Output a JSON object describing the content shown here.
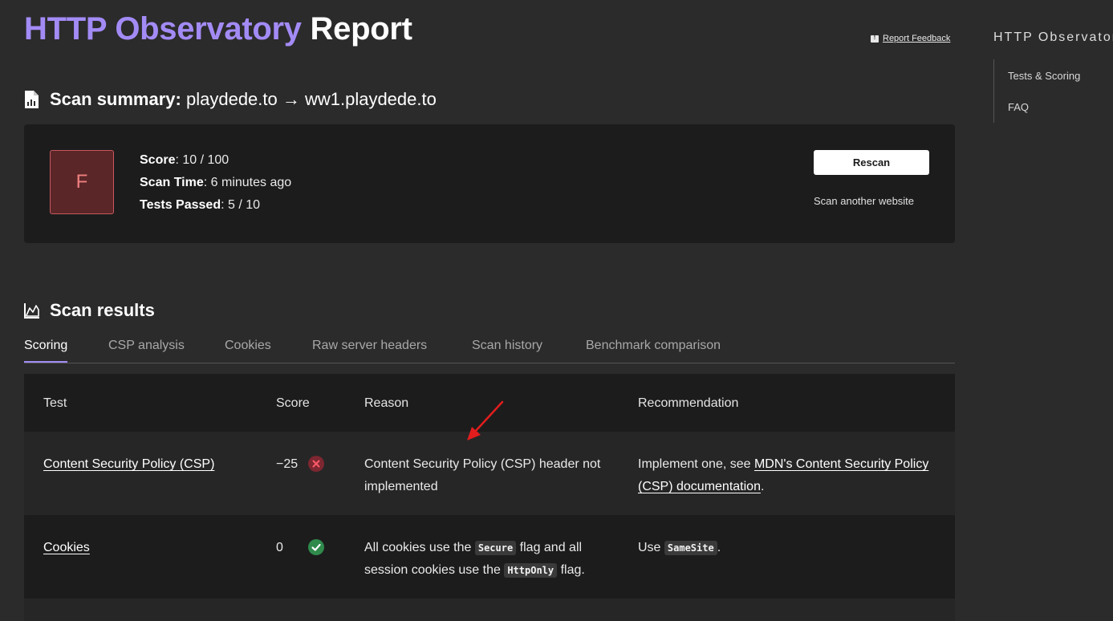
{
  "header": {
    "title_accent": "HTTP Observatory",
    "title_rest": "Report",
    "feedback_label": "Report Feedback"
  },
  "sidebar": {
    "title": "HTTP Observator",
    "items": [
      {
        "label": "Tests & Scoring"
      },
      {
        "label": "FAQ"
      }
    ]
  },
  "summary": {
    "heading_label": "Scan summary:",
    "heading_value": "playdede.to → ww1.playdede.to",
    "grade": "F",
    "score_label": "Score",
    "score_value": ": 10 / 100",
    "time_label": "Scan Time",
    "time_value": ": 6 minutes ago",
    "passed_label": "Tests Passed",
    "passed_value": ": 5 / 10",
    "rescan_label": "Rescan",
    "scan_another_label": "Scan another website"
  },
  "results": {
    "heading": "Scan results",
    "tabs": [
      {
        "label": "Scoring"
      },
      {
        "label": "CSP analysis"
      },
      {
        "label": "Cookies"
      },
      {
        "label": "Raw server headers"
      },
      {
        "label": "Scan history"
      },
      {
        "label": "Benchmark comparison"
      }
    ],
    "columns": {
      "test": "Test",
      "score": "Score",
      "reason": "Reason",
      "recommendation": "Recommendation"
    },
    "rows": [
      {
        "test": "Content Security Policy (CSP)",
        "score": "−25",
        "status": "fail",
        "reason": "Content Security Policy (CSP) header not implemented",
        "rec_prefix": "Implement one, see ",
        "rec_link": "MDN's Content Security Policy (CSP) documentation",
        "rec_suffix": "."
      },
      {
        "test": "Cookies",
        "score": "0",
        "status": "pass",
        "reason_a": "All cookies use the ",
        "reason_code1": "Secure",
        "reason_b": " flag and all session cookies use the ",
        "reason_code2": "HttpOnly",
        "reason_c": " flag.",
        "rec_prefix": "Use ",
        "rec_code": "SameSite",
        "rec_suffix": "."
      }
    ]
  },
  "colors": {
    "accent": "#a38bf6",
    "background": "#2b2b2b",
    "card": "#1c1c1c",
    "fail": "#7d2730",
    "pass": "#2f8a4c",
    "annotation": "#e21d1d"
  }
}
